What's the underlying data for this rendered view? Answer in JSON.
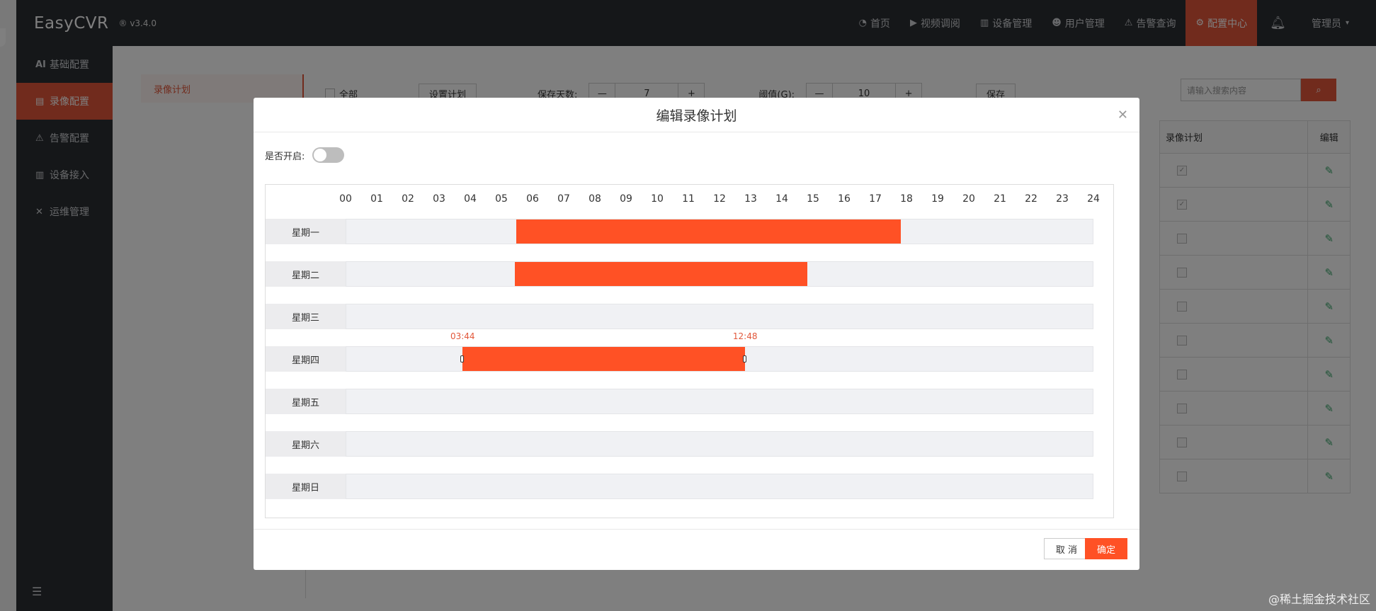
{
  "app": {
    "brand": "EasyCVR",
    "version": "® v3.4.0"
  },
  "topnav": {
    "items": [
      {
        "label": "首页",
        "icon": "dashboard-icon"
      },
      {
        "label": "视频调阅",
        "icon": "play-icon"
      },
      {
        "label": "设备管理",
        "icon": "device-icon"
      },
      {
        "label": "用户管理",
        "icon": "user-icon"
      },
      {
        "label": "告警查询",
        "icon": "alarm-icon"
      },
      {
        "label": "配置中心",
        "icon": "gear-icon",
        "active": true
      }
    ],
    "user": "管理员"
  },
  "sidebar": {
    "items": [
      {
        "label": "基础配置",
        "icon": "ai-icon"
      },
      {
        "label": "录像配置",
        "icon": "record-icon",
        "active": true
      },
      {
        "label": "告警配置",
        "icon": "alarm-icon"
      },
      {
        "label": "设备接入",
        "icon": "device-icon"
      },
      {
        "label": "运维管理",
        "icon": "tools-icon"
      }
    ]
  },
  "content": {
    "subnav": "录像计划",
    "toolbar": {
      "all": "全部",
      "set_plan": "设置计划",
      "keep_days_label": "保存天数:",
      "keep_days_value": "7",
      "threshold_label": "阈值(G):",
      "threshold_value": "10",
      "save": "保存"
    },
    "search_placeholder": "请输入搜索内容",
    "table": {
      "col_plan": "录像计划",
      "col_edit": "编辑"
    }
  },
  "modal": {
    "title": "编辑录像计划",
    "enable_label": "是否开启:",
    "enabled": false,
    "hours": [
      "00",
      "01",
      "02",
      "03",
      "04",
      "05",
      "06",
      "07",
      "08",
      "09",
      "10",
      "11",
      "12",
      "13",
      "14",
      "15",
      "16",
      "17",
      "18",
      "19",
      "20",
      "21",
      "22",
      "23",
      "24"
    ],
    "days": [
      {
        "label": "星期一",
        "segments": [
          {
            "start": 5.45,
            "end": 17.8
          }
        ]
      },
      {
        "label": "星期二",
        "segments": [
          {
            "start": 5.4,
            "end": 14.8
          }
        ]
      },
      {
        "label": "星期三",
        "segments": []
      },
      {
        "label": "星期四",
        "segments": [
          {
            "start": 3.733,
            "end": 12.8,
            "start_label": "03:44",
            "end_label": "12:48",
            "selected": true
          }
        ]
      },
      {
        "label": "星期五",
        "segments": []
      },
      {
        "label": "星期六",
        "segments": []
      },
      {
        "label": "星期日",
        "segments": []
      }
    ],
    "cancel": "取 消",
    "ok": "确定"
  },
  "footer_tag": "@稀土掘金技术社区",
  "colors": {
    "accent": "#ff5125",
    "topbar": "#2b2e33"
  }
}
